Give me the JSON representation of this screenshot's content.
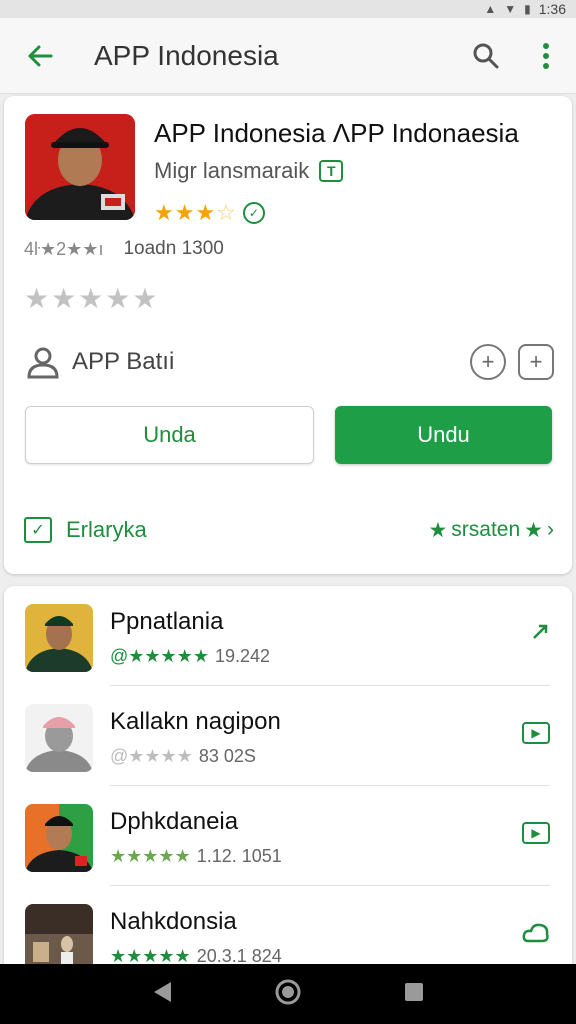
{
  "status_bar": {
    "time": "1:36"
  },
  "app_bar": {
    "title": "APP Indonesia"
  },
  "app": {
    "title": "APP Indonesia  ΛPP Indonaesia",
    "developer": "Migr lansmaraik",
    "developer_tag": "T",
    "rating_stars": 3,
    "meta_left": "4ŀ★2★★ı",
    "meta_right": "1oadn 1300",
    "big_stars": 5
  },
  "badge": {
    "label": "APP Batıi"
  },
  "buttons": {
    "secondary": "Unda",
    "primary": "Undu"
  },
  "footer": {
    "left": "Erlaryka",
    "right": "srsaten"
  },
  "list": [
    {
      "name": "Ppnatlania",
      "rating": "@★★★★★",
      "count": "19.242",
      "stars_color": "green",
      "trail": "check"
    },
    {
      "name": "Kallakn nagipon",
      "rating": "@★★★★",
      "count": "83 02S",
      "stars_color": "grey",
      "trail": "box"
    },
    {
      "name": "Dphkdaneia",
      "rating": "★★★★★",
      "count": "1.12. 1051",
      "stars_color": "mixed",
      "trail": "box"
    },
    {
      "name": "Nahkdonsia",
      "rating": "★★★★★",
      "count": "20.3.1 824",
      "stars_color": "green",
      "trail": "circle"
    }
  ],
  "colors": {
    "accent": "#1e8e3e",
    "primary_button": "#1e9e46",
    "star": "#f4a300"
  }
}
